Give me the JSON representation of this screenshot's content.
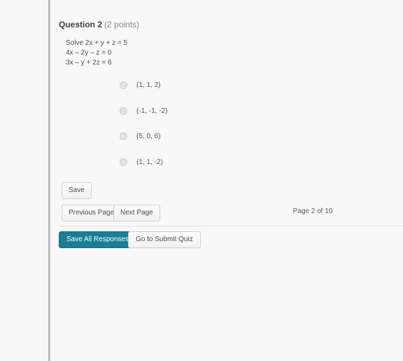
{
  "question": {
    "title": "Question 2",
    "points": "(2 points)",
    "equations": [
      "Solve 2x + y + z = 5",
      "4x – 2y – z = 0",
      "3x – y + 2z = 6"
    ],
    "options": [
      {
        "label": "(1, 1, 2)",
        "selected": false
      },
      {
        "label": "(-1, -1, -2)",
        "selected": false
      },
      {
        "label": "(5, 0, 6)",
        "selected": false
      },
      {
        "label": "(1, 1, -2)",
        "selected": false
      }
    ]
  },
  "actions": {
    "save_label": "Save",
    "previous_page_label": "Previous Page",
    "next_page_label": "Next Page",
    "page_indicator": "Page 2 of 10",
    "save_all_responses_label": "Save All Responses",
    "go_to_submit_quiz_label": "Go to Submit Quiz"
  },
  "colors": {
    "primary_button": "#1a7f96",
    "page_background": "#f7f7f7",
    "divider": "#e0e0e0"
  }
}
